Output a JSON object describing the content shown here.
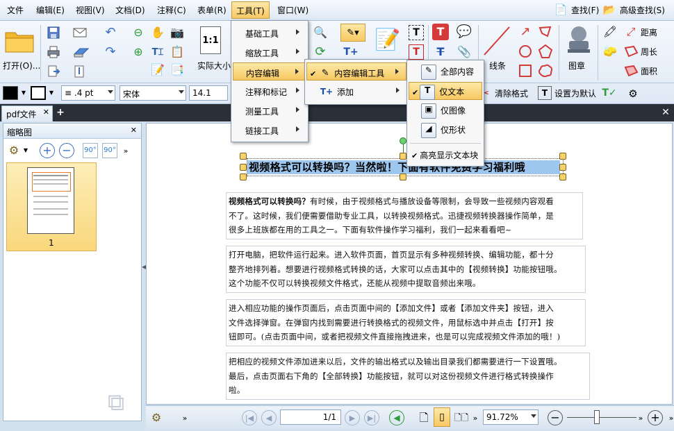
{
  "menubar": {
    "items": [
      "文件",
      "编辑(E)",
      "视图(V)",
      "文档(D)",
      "注释(C)",
      "表单(R)",
      "工具(T)",
      "窗口(W)"
    ],
    "search": "查找(F)",
    "advanced_search": "高级查找(S)"
  },
  "toolbar": {
    "open": "打开(O)...",
    "actual_size": "实际大小",
    "line": "线条",
    "stamp": "图章",
    "distance": "距离",
    "perimeter": "周长",
    "area": "面积",
    "line_width": ".4 pt",
    "font_name": "宋体",
    "font_size": "14.1",
    "clear_format": "清除格式",
    "set_default": "设置为默认"
  },
  "tabs": {
    "doc_tab": "pdf文件"
  },
  "thumbnail_panel": {
    "title": "缩略图",
    "page_label": "1"
  },
  "menu_tools": {
    "items": [
      "基础工具",
      "缩放工具",
      "内容编辑",
      "注释和标记",
      "测量工具",
      "链接工具"
    ]
  },
  "menu_content_edit": {
    "items": [
      "内容编辑工具",
      "添加"
    ]
  },
  "menu_content_edit_tool": {
    "items": [
      "全部内容",
      "仅文本",
      "仅图像",
      "仅形状"
    ],
    "highlight_blocks": "高亮显示文本块"
  },
  "document": {
    "title": "视频格式可以转换吗？当然啦！下面有软件免费学习福利哦",
    "p1_bold": "视频格式可以转换吗？",
    "p1_line1": "有时候，由于视频格式与播放设备等限制，会导致一些视频内容观看",
    "p1_line2": "不了。这时候，我们便需要借助专业工具，以转换视频格式。迅捷视频转换器操作简单，是",
    "p1_line3": "很多上班族都在用的工具之一。下面有软件操作学习福利，我们一起来看看吧~",
    "p2_line1": "打开电脑，把软件运行起来。进入软件页面，首页显示有多种视频转换、编辑功能，都十分",
    "p2_line2": "整齐地排列着。想要进行视频格式转换的话，大家可以点击其中的【视频转换】功能按钮哦。",
    "p2_line3": "这个功能不仅可以转换视频文件格式，还能从视频中提取音频出来哦。",
    "p3_line1": "进入相应功能的操作页面后，点击页面中间的【添加文件】或者【添加文件夹】按钮，进入",
    "p3_line2": "文件选择弹窗。在弹窗内找到需要进行转换格式的视频文件，用鼠标选中并点击【打开】按",
    "p3_line3": "钮即可。(点击页面中间，或者把视频文件直接拖拽进来，也是可以完成视频文件添加的哦！)",
    "p4_line1": "把相应的视频文件添加进来以后，文件的输出格式以及输出目录我们都需要进行一下设置哦。",
    "p4_line2": "最后，点击页面右下角的【全部转换】功能按钮，就可以对这份视频文件进行格式转换操作",
    "p4_line3": "啦。"
  },
  "statusbar": {
    "page": "1/1",
    "zoom": "91.72%"
  }
}
